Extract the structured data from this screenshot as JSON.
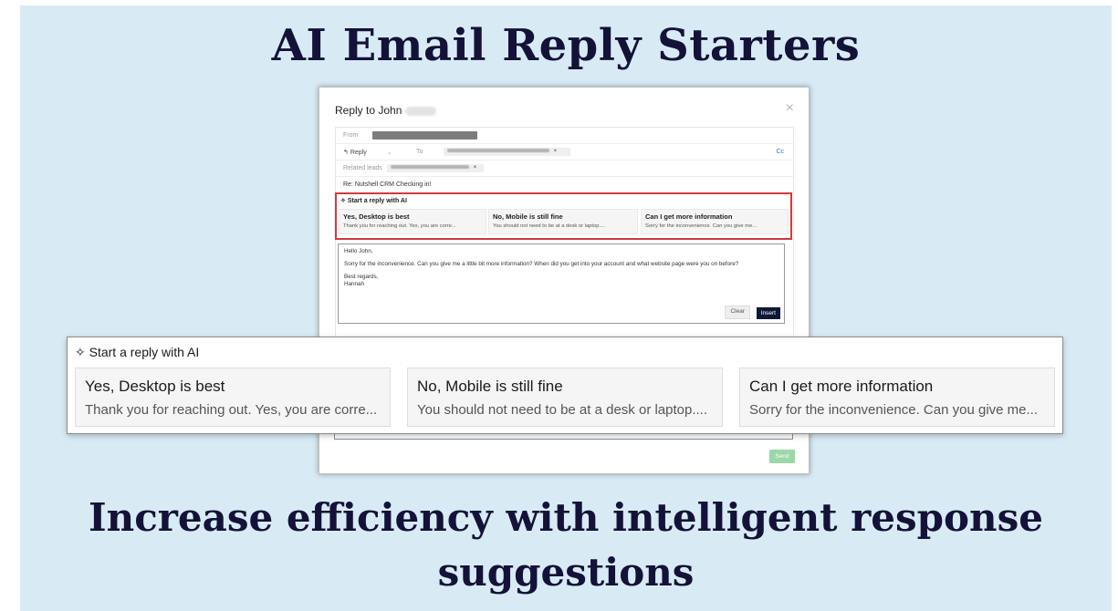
{
  "headline_top": "AI Email Reply Starters",
  "headline_bottom": "Increase efficiency with intelligent response suggestions",
  "modal": {
    "title": "Reply to John",
    "close_symbol": "×",
    "from_label": "From",
    "reply_mode": "Reply",
    "to_label": "To",
    "cc_label": "Cc",
    "related_leads_label": "Related leads",
    "chip_remove": "×",
    "subject": "Re: Nutshell CRM Checking in!",
    "ai_header": "Start a reply with AI",
    "suggestions": [
      {
        "title": "Yes, Desktop is best",
        "snippet": "Thank you for reaching out. Yes, you are corre..."
      },
      {
        "title": "No, Mobile is still fine",
        "snippet": "You should not need to be at a desk or laptop...."
      },
      {
        "title": "Can I get more information",
        "snippet": "Sorry for the inconvenience. Can you give me..."
      }
    ],
    "body": {
      "greeting": "Hello John,",
      "paragraph": "Sorry for the inconvenience. Can you give me a little bit more information? When did you get into your account and what website page were you on before?",
      "closing": "Best regards,",
      "signature": "Hannah"
    },
    "clear_label": "Clear",
    "insert_label": "Insert",
    "send_label": "Send"
  },
  "colors": {
    "background": "#d8ebf5",
    "headline": "#141238",
    "highlight_border": "#d23a3a",
    "insert_button": "#0f1936",
    "send_button": "#9bd8a7"
  }
}
